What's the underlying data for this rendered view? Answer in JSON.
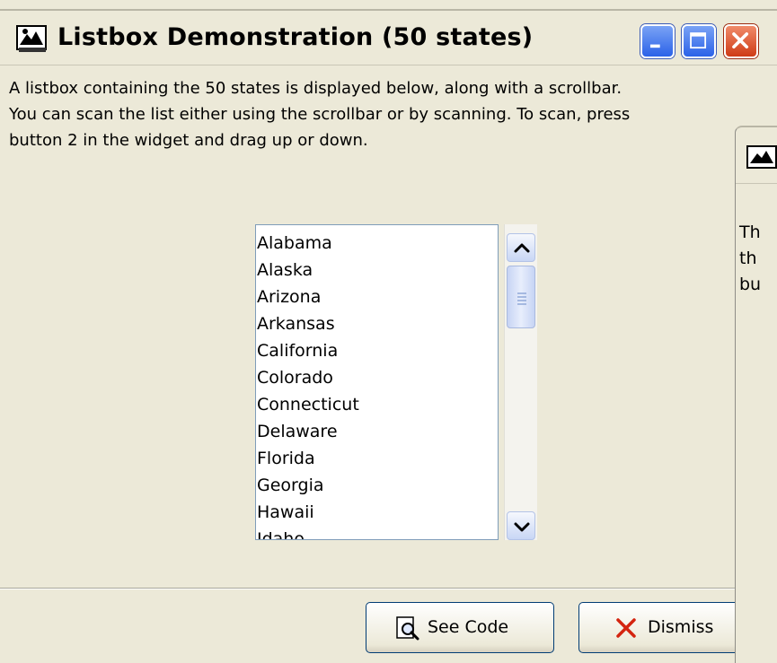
{
  "window": {
    "title": "Listbox Demonstration (50 states)",
    "description_lines": [
      "A listbox containing the 50 states is displayed below, along with a scrollbar.",
      "You can scan the list either using the scrollbar or by scanning.  To scan, press",
      "button 2 in the widget and drag up or down."
    ]
  },
  "listbox": {
    "items": [
      "Alabama",
      "Alaska",
      "Arizona",
      "Arkansas",
      "California",
      "Colorado",
      "Connecticut",
      "Delaware",
      "Florida",
      "Georgia",
      "Hawaii",
      "Idaho"
    ]
  },
  "buttons": {
    "see_code": "See Code",
    "dismiss": "Dismiss"
  },
  "background_window": {
    "text_fragments": [
      "Th",
      "th",
      "bu"
    ]
  },
  "colors": {
    "dialog_bg": "#ece9d8",
    "titlebar_button_blue": "#2b62e8",
    "close_button_red": "#cf3b16",
    "listbox_border": "#7f9db9"
  },
  "icons": {
    "title": "app-icon",
    "minimize": "minimize-icon",
    "maximize": "maximize-icon",
    "close": "close-icon",
    "see_code": "magnifier-icon",
    "dismiss": "x-icon"
  }
}
